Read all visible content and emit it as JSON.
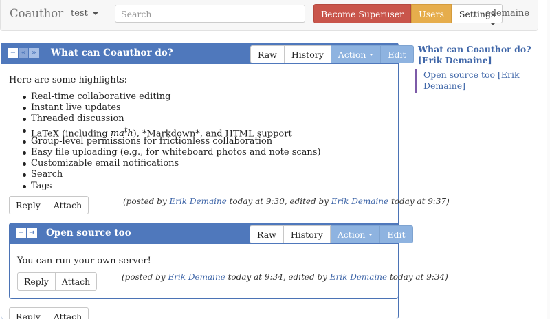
{
  "navbar": {
    "brand": "Coauthor",
    "group": "test",
    "search_placeholder": "Search",
    "become_superuser": "Become Superuser",
    "users": "Users",
    "settings": "Settings",
    "user": "edemaine"
  },
  "colors": {
    "panel_header": "#4f78bc",
    "superuser_button": "#c9554b",
    "users_button": "#e6ad4c",
    "link": "#3f66a8",
    "sidebar_rule": "#7d5ba8"
  },
  "panel1": {
    "controls": [
      "−",
      "«",
      "»"
    ],
    "title": "What can Coauthor do?",
    "tools": {
      "raw": "Raw",
      "history": "History",
      "action": "Action",
      "edit": "Edit"
    },
    "intro": "Here are some highlights:",
    "highlights": [
      "Real-time collaborative editing",
      "Instant live updates",
      "Threaded discussion",
      "Group-level permissions for frictionless collaboration",
      "Easy file uploading (e.g., for whiteboard photos and note scans)",
      "Customizable email notifications",
      "Search",
      "Tags"
    ],
    "latex_line": {
      "prefix": "LaTeX (including ",
      "math_base": "ma",
      "math_sup": "t",
      "math_end": "h",
      "suffix": "), *Markdown*, and HTML support"
    },
    "reply": "Reply",
    "attach": "Attach",
    "posted": {
      "open": "(posted by ",
      "author": "Erik Demaine",
      "posted_time": " today at 9:30, edited by ",
      "editor": "Erik Demaine",
      "edited_time": " today at 9:37)"
    }
  },
  "panel2": {
    "controls": [
      "−",
      "→"
    ],
    "title": "Open source too",
    "tools": {
      "raw": "Raw",
      "history": "History",
      "action": "Action",
      "edit": "Edit"
    },
    "body": "You can run your own server!",
    "reply": "Reply",
    "attach": "Attach",
    "posted": {
      "open": "(posted by ",
      "author": "Erik Demaine",
      "posted_time": " today at 9:34, edited by ",
      "editor": "Erik Demaine",
      "edited_time": " today at 9:34)"
    }
  },
  "bottom": {
    "reply": "Reply",
    "attach": "Attach"
  },
  "sidebar": {
    "toc1": "What can Coauthor do? [Erik Demaine]",
    "toc2": "Open source too [Erik Demaine]"
  }
}
